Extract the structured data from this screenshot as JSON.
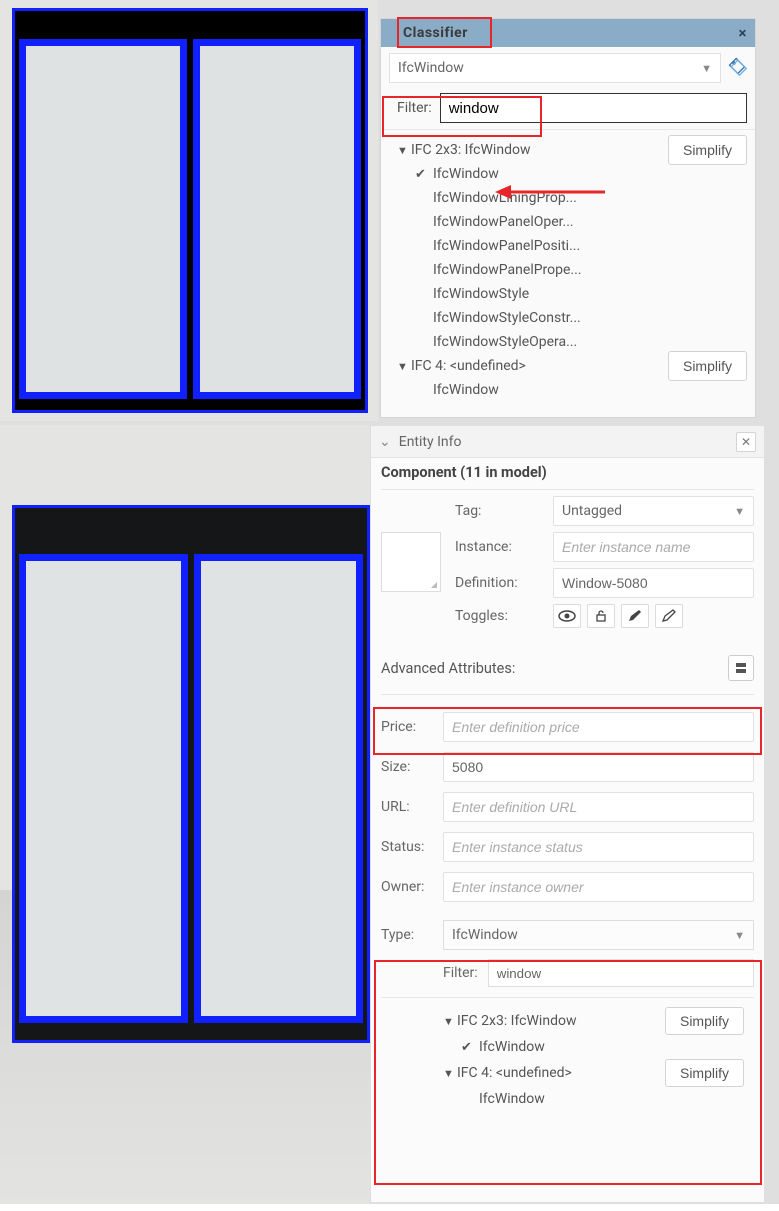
{
  "classifier": {
    "title": "Classifier",
    "selected": "IfcWindow",
    "filter_label": "Filter:",
    "filter_value": "window",
    "groups": [
      {
        "header": "IFC 2x3: IfcWindow",
        "simplify": "Simplify",
        "items": [
          {
            "label": "IfcWindow",
            "checked": true
          },
          {
            "label": "IfcWindowLiningProp..."
          },
          {
            "label": "IfcWindowPanelOper..."
          },
          {
            "label": "IfcWindowPanelPositi..."
          },
          {
            "label": "IfcWindowPanelPrope..."
          },
          {
            "label": "IfcWindowStyle"
          },
          {
            "label": "IfcWindowStyleConstr..."
          },
          {
            "label": "IfcWindowStyleOpera..."
          }
        ]
      },
      {
        "header": "IFC 4: <undefined>",
        "simplify": "Simplify",
        "items": [
          {
            "label": "IfcWindow"
          }
        ]
      }
    ]
  },
  "entity": {
    "header": "Entity Info",
    "component_line": "Component (11 in model)",
    "labels": {
      "tag": "Tag:",
      "instance": "Instance:",
      "definition": "Definition:",
      "toggles": "Toggles:",
      "price": "Price:",
      "size": "Size:",
      "url": "URL:",
      "status": "Status:",
      "owner": "Owner:",
      "type": "Type:",
      "filter": "Filter:",
      "adv": "Advanced Attributes:"
    },
    "values": {
      "tag": "Untagged",
      "definition": "Window-5080",
      "size": "5080",
      "type": "IfcWindow",
      "filter": "window"
    },
    "placeholders": {
      "instance": "Enter instance name",
      "price": "Enter definition price",
      "url": "Enter definition URL",
      "status": "Enter instance status",
      "owner": "Enter instance owner"
    },
    "type_tree": {
      "groups": [
        {
          "header": "IFC 2x3: IfcWindow",
          "simplify": "Simplify",
          "items": [
            {
              "label": "IfcWindow",
              "checked": true
            }
          ]
        },
        {
          "header": "IFC 4: <undefined>",
          "simplify": "Simplify",
          "items": [
            {
              "label": "IfcWindow"
            }
          ]
        }
      ]
    }
  }
}
